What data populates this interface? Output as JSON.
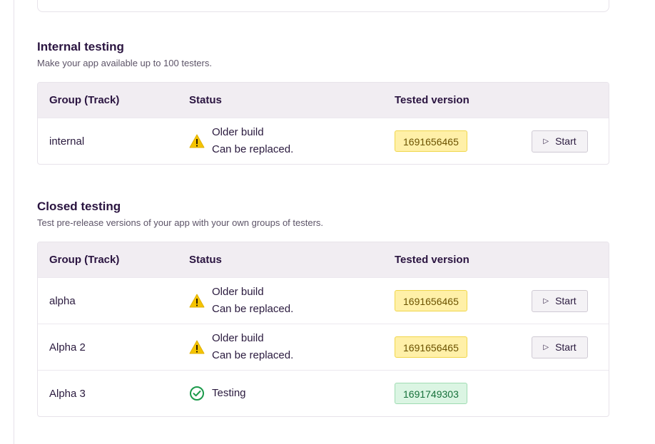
{
  "internal": {
    "title": "Internal testing",
    "subtitle": "Make your app available up to 100 testers.",
    "headers": {
      "group": "Group (Track)",
      "status": "Status",
      "version": "Tested version"
    },
    "rows": [
      {
        "group": "internal",
        "status_line1": "Older build",
        "status_line2": "Can be replaced.",
        "version": "1691656465",
        "action": "Start"
      }
    ]
  },
  "closed": {
    "title": "Closed testing",
    "subtitle": "Test pre-release versions of your app with your own groups of testers.",
    "headers": {
      "group": "Group (Track)",
      "status": "Status",
      "version": "Tested version"
    },
    "rows": [
      {
        "group": "alpha",
        "status_line1": "Older build",
        "status_line2": "Can be replaced.",
        "version": "1691656465",
        "action": "Start"
      },
      {
        "group": "Alpha 2",
        "status_line1": "Older build",
        "status_line2": "Can be replaced.",
        "version": "1691656465",
        "action": "Start"
      },
      {
        "group": "Alpha 3",
        "status_line1": "Testing",
        "version": "1691749303"
      }
    ]
  },
  "icons": {
    "warning": "warning-icon",
    "check": "check-circle-icon",
    "play": "play-icon"
  },
  "colors": {
    "warning": "#f5c400",
    "success": "#1a9a4a",
    "accent": "#2a1440"
  }
}
